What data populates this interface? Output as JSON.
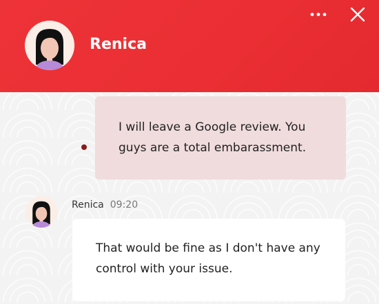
{
  "header": {
    "agent_name": "Renica",
    "menu_icon": "more-horizontal-icon",
    "close_icon": "close-icon",
    "background_color": "#ee3338"
  },
  "messages": [
    {
      "sender": "user",
      "text": "I will leave a Google review. You guys are a total embarassment.",
      "bubble_color": "#f0dcdd"
    },
    {
      "sender": "agent",
      "name": "Renica",
      "time": "09:20",
      "text": "That would be fine as I don't have any control with your issue.",
      "bubble_color": "#ffffff"
    }
  ]
}
